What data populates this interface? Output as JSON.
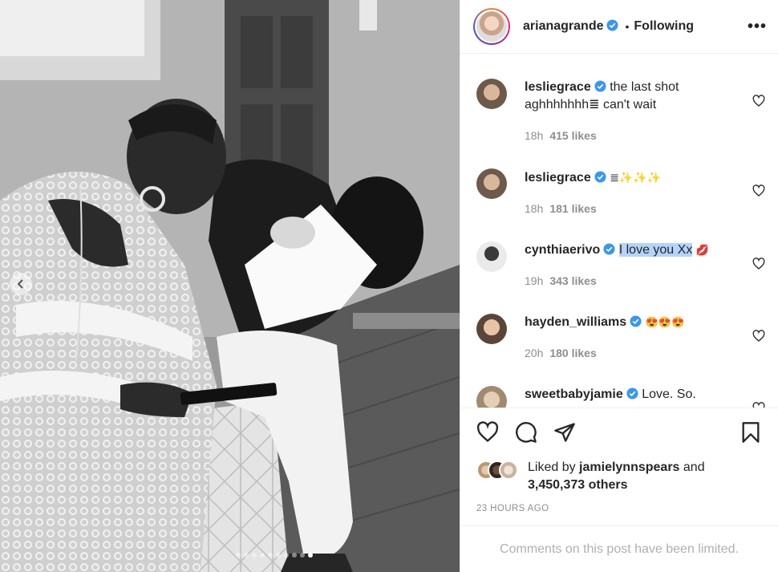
{
  "post": {
    "username": "arianagrande",
    "follow_status": "Following",
    "separator": "•",
    "more_label": "•••"
  },
  "comments": [
    {
      "username": "lesliegrace",
      "verified": true,
      "text": "the last shot aghhhhhhh≣ can't wait",
      "time": "18h",
      "likes": "415 likes",
      "highlighted": false
    },
    {
      "username": "lesliegrace",
      "verified": true,
      "text": "≣✨✨✨",
      "time": "18h",
      "likes": "181 likes",
      "highlighted": false
    },
    {
      "username": "cynthiaerivo",
      "verified": true,
      "text": "I love you Xx",
      "emoji": "💋",
      "time": "19h",
      "likes": "343 likes",
      "highlighted": true
    },
    {
      "username": "hayden_williams",
      "verified": true,
      "text": "😍😍😍",
      "time": "20h",
      "likes": "180 likes",
      "highlighted": false
    },
    {
      "username": "sweetbabyjamie",
      "verified": true,
      "text": "Love. So.",
      "time": "",
      "likes": "",
      "highlighted": false
    }
  ],
  "likes": {
    "prefix": "Liked by",
    "user": "jamielynnspears",
    "and": "and",
    "count": "3,450,373 others"
  },
  "timestamp": "23 HOURS AGO",
  "footer": "Comments on this post have been limited.",
  "carousel": {
    "total": 10,
    "active": 10
  },
  "colors": {
    "verified": "#3897f0",
    "highlight": "#b3d4fc",
    "muted": "#8e8e8e"
  },
  "icons": [
    "heart-icon",
    "comment-icon",
    "share-icon",
    "bookmark-icon",
    "verified-badge-icon",
    "chevron-left-icon",
    "more-icon"
  ]
}
